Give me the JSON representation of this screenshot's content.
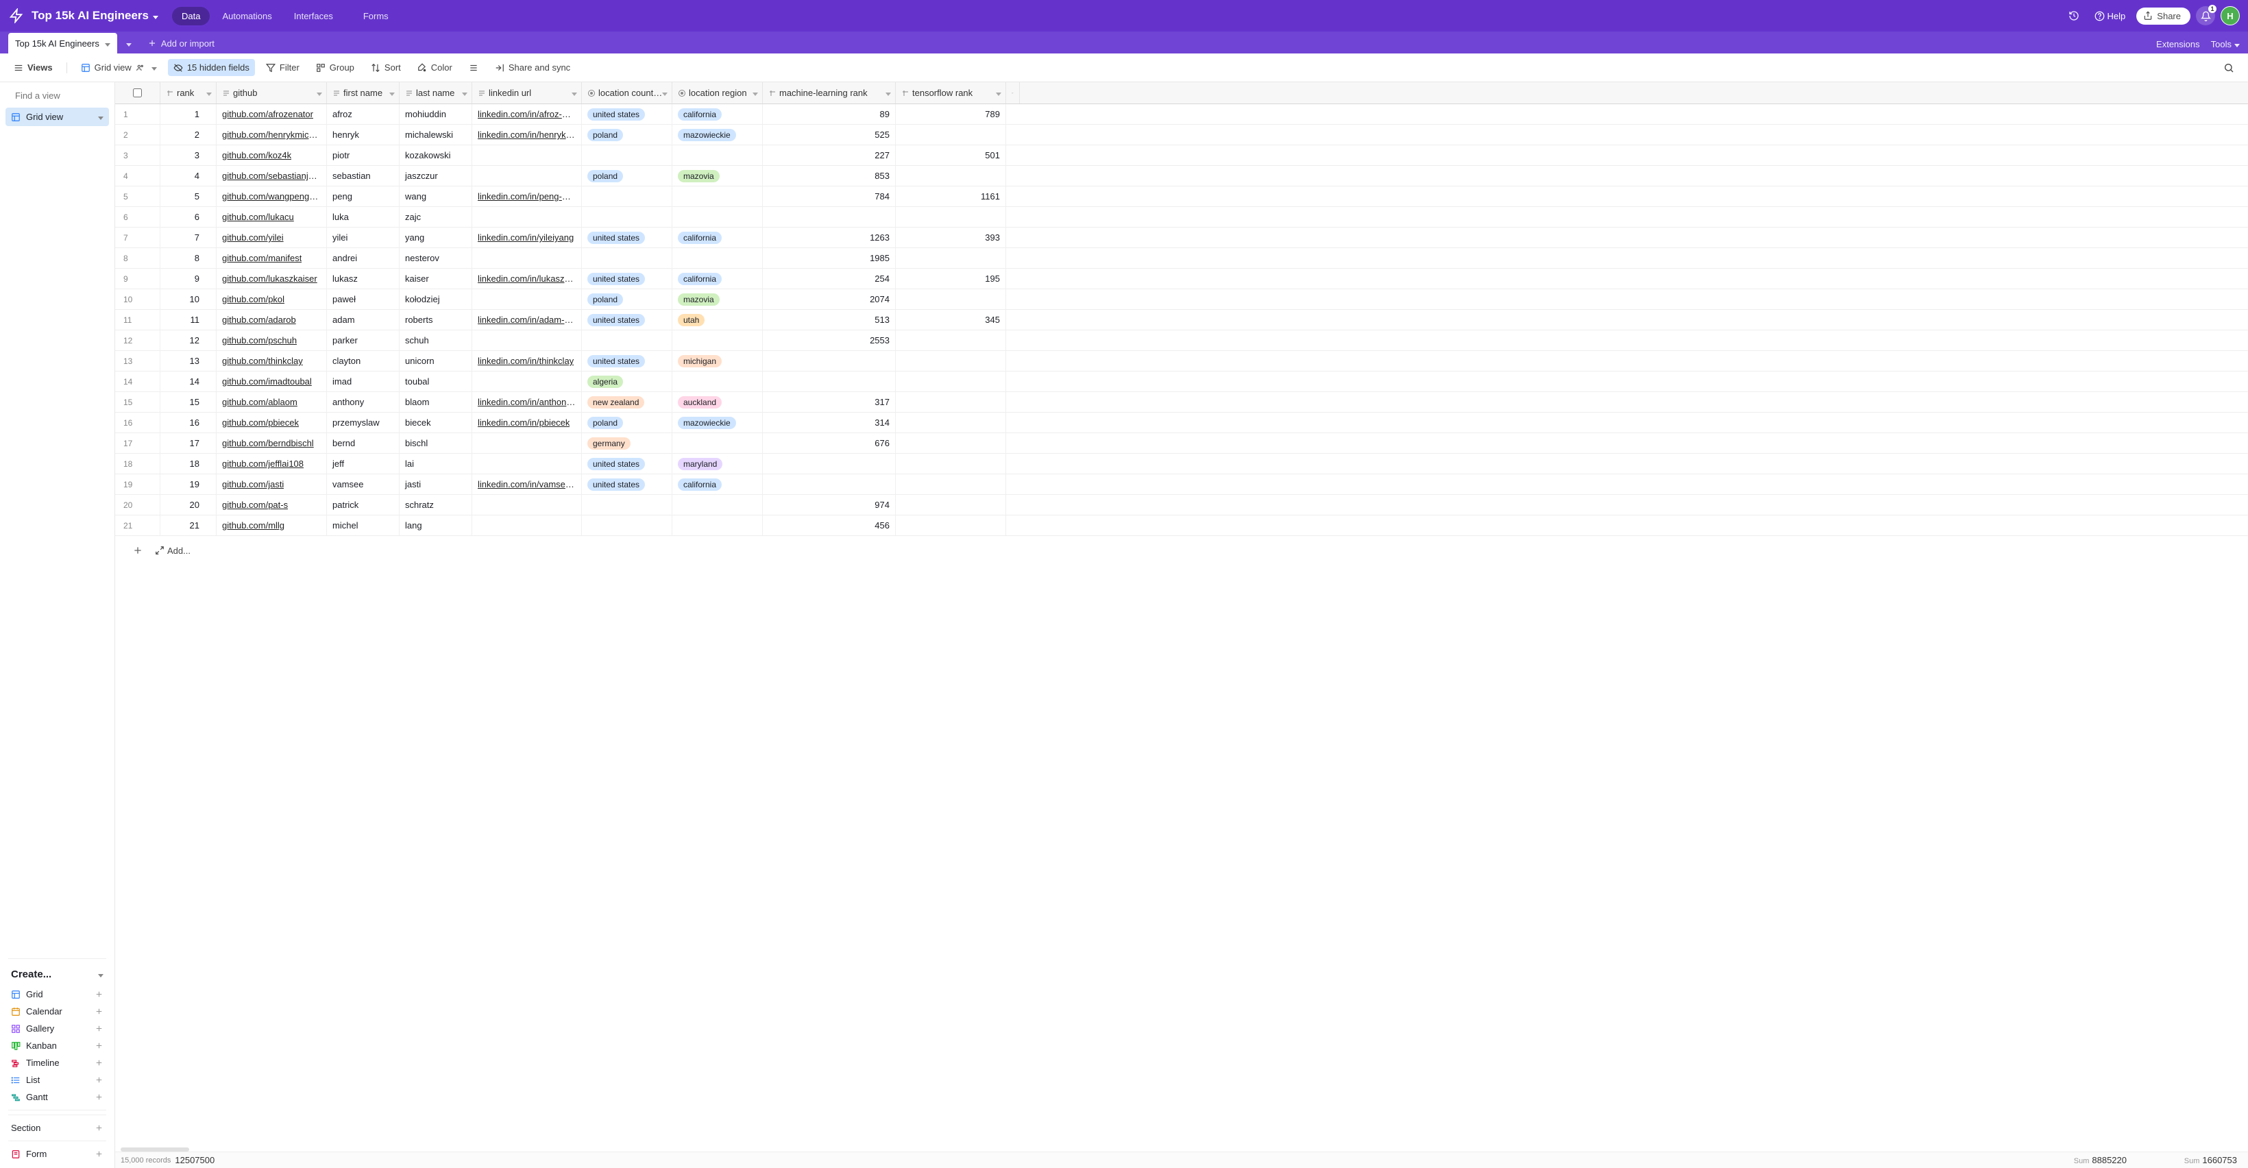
{
  "header": {
    "base_title": "Top 15k AI Engineers",
    "nav": {
      "data": "Data",
      "automations": "Automations",
      "interfaces": "Interfaces",
      "forms": "Forms"
    },
    "help": "Help",
    "share": "Share",
    "notif_count": "1",
    "avatar_initial": "H"
  },
  "table_tabs": {
    "tab1": "Top 15k AI Engineers",
    "add": "Add or import",
    "extensions": "Extensions",
    "tools": "Tools"
  },
  "toolbar": {
    "views": "Views",
    "grid_view": "Grid view",
    "hidden_fields": "15 hidden fields",
    "filter": "Filter",
    "group": "Group",
    "sort": "Sort",
    "color": "Color",
    "share_sync": "Share and sync"
  },
  "sidebar": {
    "find_placeholder": "Find a view",
    "view1": "Grid view",
    "create": "Create...",
    "items": {
      "grid": "Grid",
      "calendar": "Calendar",
      "gallery": "Gallery",
      "kanban": "Kanban",
      "timeline": "Timeline",
      "list": "List",
      "gantt": "Gantt",
      "section": "Section",
      "form": "Form"
    }
  },
  "columns": {
    "rank": "rank",
    "github": "github",
    "first_name": "first name",
    "last_name": "last name",
    "linkedin": "linkedin url",
    "country": "location count…",
    "region": "location region",
    "ml_rank": "machine-learning rank",
    "tf_rank": "tensorflow rank"
  },
  "pill_colors": {
    "united states": "#cfe5ff",
    "poland": "#cfe5ff",
    "new zealand": "#ffe0cc",
    "algeria": "#d0f0c0",
    "germany": "#ffe0cc",
    "california": "#cfe5ff",
    "mazowieckie": "#cfe5ff",
    "mazovia": "#d0f0c0",
    "utah": "#ffe0b3",
    "michigan": "#ffe0cc",
    "auckland": "#ffd6e7",
    "maryland": "#e6d6ff"
  },
  "rows": [
    {
      "n": 1,
      "rank": 1,
      "github": "github.com/afrozenator",
      "fn": "afroz",
      "ln": "mohiuddin",
      "li": "linkedin.com/in/afroz-mo…",
      "country": "united states",
      "region": "california",
      "ml": 89,
      "tf": 789
    },
    {
      "n": 2,
      "rank": 2,
      "github": "github.com/henrykmichal…",
      "fn": "henryk",
      "ln": "michalewski",
      "li": "linkedin.com/in/henryk-mi…",
      "country": "poland",
      "region": "mazowieckie",
      "ml": 525,
      "tf": ""
    },
    {
      "n": 3,
      "rank": 3,
      "github": "github.com/koz4k",
      "fn": "piotr",
      "ln": "kozakowski",
      "li": "",
      "country": "",
      "region": "",
      "ml": 227,
      "tf": 501
    },
    {
      "n": 4,
      "rank": 4,
      "github": "github.com/sebastianjasz…",
      "fn": "sebastian",
      "ln": "jaszczur",
      "li": "",
      "country": "poland",
      "region": "mazovia",
      "ml": 853,
      "tf": ""
    },
    {
      "n": 5,
      "rank": 5,
      "github": "github.com/wangpengmit",
      "fn": "peng",
      "ln": "wang",
      "li": "linkedin.com/in/peng-wan…",
      "country": "",
      "region": "",
      "ml": 784,
      "tf": 1161
    },
    {
      "n": 6,
      "rank": 6,
      "github": "github.com/lukacu",
      "fn": "luka",
      "ln": "zajc",
      "li": "",
      "country": "",
      "region": "",
      "ml": "",
      "tf": ""
    },
    {
      "n": 7,
      "rank": 7,
      "github": "github.com/yilei",
      "fn": "yilei",
      "ln": "yang",
      "li": "linkedin.com/in/yileiyang",
      "country": "united states",
      "region": "california",
      "ml": 1263,
      "tf": 393
    },
    {
      "n": 8,
      "rank": 8,
      "github": "github.com/manifest",
      "fn": "andrei",
      "ln": "nesterov",
      "li": "",
      "country": "",
      "region": "",
      "ml": 1985,
      "tf": ""
    },
    {
      "n": 9,
      "rank": 9,
      "github": "github.com/lukaszkaiser",
      "fn": "lukasz",
      "ln": "kaiser",
      "li": "linkedin.com/in/lukaszkais…",
      "country": "united states",
      "region": "california",
      "ml": 254,
      "tf": 195
    },
    {
      "n": 10,
      "rank": 10,
      "github": "github.com/pkol",
      "fn": "paweł",
      "ln": "kołodziej",
      "li": "",
      "country": "poland",
      "region": "mazovia",
      "ml": 2074,
      "tf": ""
    },
    {
      "n": 11,
      "rank": 11,
      "github": "github.com/adarob",
      "fn": "adam",
      "ln": "roberts",
      "li": "linkedin.com/in/adam-rob…",
      "country": "united states",
      "region": "utah",
      "ml": 513,
      "tf": 345
    },
    {
      "n": 12,
      "rank": 12,
      "github": "github.com/pschuh",
      "fn": "parker",
      "ln": "schuh",
      "li": "",
      "country": "",
      "region": "",
      "ml": 2553,
      "tf": ""
    },
    {
      "n": 13,
      "rank": 13,
      "github": "github.com/thinkclay",
      "fn": "clayton",
      "ln": "unicorn",
      "li": "linkedin.com/in/thinkclay",
      "country": "united states",
      "region": "michigan",
      "ml": "",
      "tf": ""
    },
    {
      "n": 14,
      "rank": 14,
      "github": "github.com/imadtoubal",
      "fn": "imad",
      "ln": "toubal",
      "li": "",
      "country": "algeria",
      "region": "",
      "ml": "",
      "tf": ""
    },
    {
      "n": 15,
      "rank": 15,
      "github": "github.com/ablaom",
      "fn": "anthony",
      "ln": "blaom",
      "li": "linkedin.com/in/anthony-…",
      "country": "new zealand",
      "region": "auckland",
      "ml": 317,
      "tf": ""
    },
    {
      "n": 16,
      "rank": 16,
      "github": "github.com/pbiecek",
      "fn": "przemyslaw",
      "ln": "biecek",
      "li": "linkedin.com/in/pbiecek",
      "country": "poland",
      "region": "mazowieckie",
      "ml": 314,
      "tf": ""
    },
    {
      "n": 17,
      "rank": 17,
      "github": "github.com/berndbischl",
      "fn": "bernd",
      "ln": "bischl",
      "li": "",
      "country": "germany",
      "region": "",
      "ml": 676,
      "tf": ""
    },
    {
      "n": 18,
      "rank": 18,
      "github": "github.com/jefflai108",
      "fn": "jeff",
      "ln": "lai",
      "li": "",
      "country": "united states",
      "region": "maryland",
      "ml": "",
      "tf": ""
    },
    {
      "n": 19,
      "rank": 19,
      "github": "github.com/jasti",
      "fn": "vamsee",
      "ln": "jasti",
      "li": "linkedin.com/in/vamsee-j…",
      "country": "united states",
      "region": "california",
      "ml": "",
      "tf": ""
    },
    {
      "n": 20,
      "rank": 20,
      "github": "github.com/pat-s",
      "fn": "patrick",
      "ln": "schratz",
      "li": "",
      "country": "",
      "region": "",
      "ml": 974,
      "tf": ""
    },
    {
      "n": 21,
      "rank": 21,
      "github": "github.com/mllg",
      "fn": "michel",
      "ln": "lang",
      "li": "",
      "country": "",
      "region": "",
      "ml": 456,
      "tf": ""
    }
  ],
  "footer": {
    "records_label": "15,000 records",
    "records_count": "12507500",
    "sum_label": "Sum",
    "sum_ml": "8885220",
    "sum_tf": "1660753",
    "add": "Add..."
  }
}
